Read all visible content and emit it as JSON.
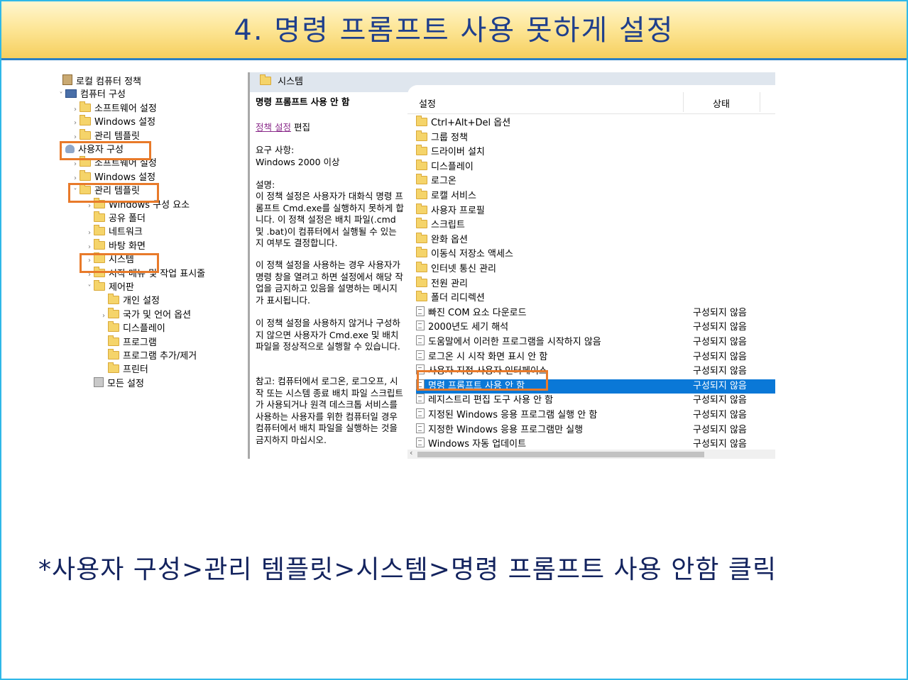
{
  "slide": {
    "title": "4. 명령 프롬프트 사용 못하게 설정",
    "caption": "*사용자 구성>관리 템플릿>시스템>명령 프롬프트 사용 안함 클릭"
  },
  "tree": {
    "items": [
      {
        "label": "로컬 컴퓨터 정책",
        "icon": "book-icon",
        "chev": ""
      },
      {
        "label": "컴퓨터 구성",
        "icon": "computer-icon",
        "chev": "˅"
      },
      {
        "label": "소프트웨어 설정",
        "icon": "folder-icon",
        "chev": "›"
      },
      {
        "label": "Windows 설정",
        "icon": "folder-icon",
        "chev": "›"
      },
      {
        "label": "관리 템플릿",
        "icon": "folder-icon",
        "chev": "›"
      },
      {
        "label": "사용자 구성",
        "icon": "user-icon",
        "chev": "˅"
      },
      {
        "label": "소프트웨어 설정",
        "icon": "folder-icon",
        "chev": "›"
      },
      {
        "label": "Windows 설정",
        "icon": "folder-icon",
        "chev": "›"
      },
      {
        "label": "관리 템플릿",
        "icon": "folder-icon",
        "chev": "˅"
      },
      {
        "label": "Windows 구성 요소",
        "icon": "folder-icon",
        "chev": "›"
      },
      {
        "label": "공유 폴더",
        "icon": "folder-icon",
        "chev": ""
      },
      {
        "label": "네트워크",
        "icon": "folder-icon",
        "chev": "›"
      },
      {
        "label": "바탕 화면",
        "icon": "folder-icon",
        "chev": "›"
      },
      {
        "label": "시스템",
        "icon": "folder-icon",
        "chev": "›"
      },
      {
        "label": "시작 메뉴 및 작업 표시줄",
        "icon": "folder-icon",
        "chev": "›"
      },
      {
        "label": "제어판",
        "icon": "folder-icon",
        "chev": "˅"
      },
      {
        "label": "개인 설정",
        "icon": "folder-icon",
        "chev": ""
      },
      {
        "label": "국가 및 언어 옵션",
        "icon": "folder-icon",
        "chev": "›"
      },
      {
        "label": "디스플레이",
        "icon": "folder-icon",
        "chev": ""
      },
      {
        "label": "프로그램",
        "icon": "folder-icon",
        "chev": ""
      },
      {
        "label": "프로그램 추가/제거",
        "icon": "folder-icon",
        "chev": ""
      },
      {
        "label": "프린터",
        "icon": "folder-icon",
        "chev": ""
      },
      {
        "label": "모든 설정",
        "icon": "all-settings-icon",
        "chev": ""
      }
    ]
  },
  "panel": {
    "header": "시스템"
  },
  "description": {
    "title": "명령 프롬프트 사용 안 함",
    "link": "정책 설정",
    "link_suffix": " 편집",
    "req_label": "요구 사항:",
    "req_value": "Windows 2000 이상",
    "desc_label": "설명:",
    "p1": "이 정책 설정은 사용자가 대화식 명령 프롬프트 Cmd.exe를 실행하지 못하게 합니다. 이 정책 설정은 배치 파일(.cmd 및 .bat)이 컴퓨터에서 실행될 수 있는지 여부도 결정합니다.",
    "p2": "이 정책 설정을 사용하는 경우 사용자가 명령 창을 열려고 하면 설정에서 해당 작업을 금지하고 있음을 설명하는 메시지가 표시됩니다.",
    "p3": "이 정책 설정을 사용하지 않거나 구성하지 않으면 사용자가 Cmd.exe 및 배치 파일을 정상적으로 실행할 수 있습니다.",
    "p4": "참고: 컴퓨터에서 로그온, 로그오프, 시작 또는 시스템 종료 배치 파일 스크립트가 사용되거나 원격 데스크톱 서비스를 사용하는 사용자를 위한 컴퓨터일 경우 컴퓨터에서 배치 파일을 실행하는 것을 금지하지 마십시오."
  },
  "list": {
    "col_setting": "설정",
    "col_state": "상태",
    "rows": [
      {
        "label": "Ctrl+Alt+Del 옵션",
        "type": "folder",
        "state": ""
      },
      {
        "label": "그룹 정책",
        "type": "folder",
        "state": ""
      },
      {
        "label": "드라이버 설치",
        "type": "folder",
        "state": ""
      },
      {
        "label": "디스플레이",
        "type": "folder",
        "state": ""
      },
      {
        "label": "로그온",
        "type": "folder",
        "state": ""
      },
      {
        "label": "로캘 서비스",
        "type": "folder",
        "state": ""
      },
      {
        "label": "사용자 프로필",
        "type": "folder",
        "state": ""
      },
      {
        "label": "스크립트",
        "type": "folder",
        "state": ""
      },
      {
        "label": "완화 옵션",
        "type": "folder",
        "state": ""
      },
      {
        "label": "이동식 저장소 액세스",
        "type": "folder",
        "state": ""
      },
      {
        "label": "인터넷 통신 관리",
        "type": "folder",
        "state": ""
      },
      {
        "label": "전원 관리",
        "type": "folder",
        "state": ""
      },
      {
        "label": "폴더 리디렉션",
        "type": "folder",
        "state": ""
      },
      {
        "label": "빠진 COM 요소 다운로드",
        "type": "policy",
        "state": "구성되지 않음"
      },
      {
        "label": "2000년도 세기 해석",
        "type": "policy",
        "state": "구성되지 않음"
      },
      {
        "label": "도움말에서 이러한 프로그램을 시작하지 않음",
        "type": "policy",
        "state": "구성되지 않음"
      },
      {
        "label": "로그온 시 시작 화면 표시 안 함",
        "type": "policy",
        "state": "구성되지 않음"
      },
      {
        "label": "사용자 지정 사용자 인터페이스",
        "type": "policy",
        "state": "구성되지 않음"
      },
      {
        "label": "명령 프롬프트 사용 안 함",
        "type": "policy",
        "state": "구성되지 않음"
      },
      {
        "label": "레지스트리 편집 도구 사용 안 함",
        "type": "policy",
        "state": "구성되지 않음"
      },
      {
        "label": "지정된 Windows 응용 프로그램 실행 안 함",
        "type": "policy",
        "state": "구성되지 않음"
      },
      {
        "label": "지정한 Windows 응용 프로그램만 실행",
        "type": "policy",
        "state": "구성되지 않음"
      },
      {
        "label": "Windows 자동 업데이트",
        "type": "policy",
        "state": "구성되지 않음"
      }
    ],
    "selected_index": 18
  },
  "colors": {
    "highlight_border": "#e87a2a",
    "selection": "#0a78d7",
    "title_text": "#1f3f8c",
    "caption_text": "#13235e"
  }
}
